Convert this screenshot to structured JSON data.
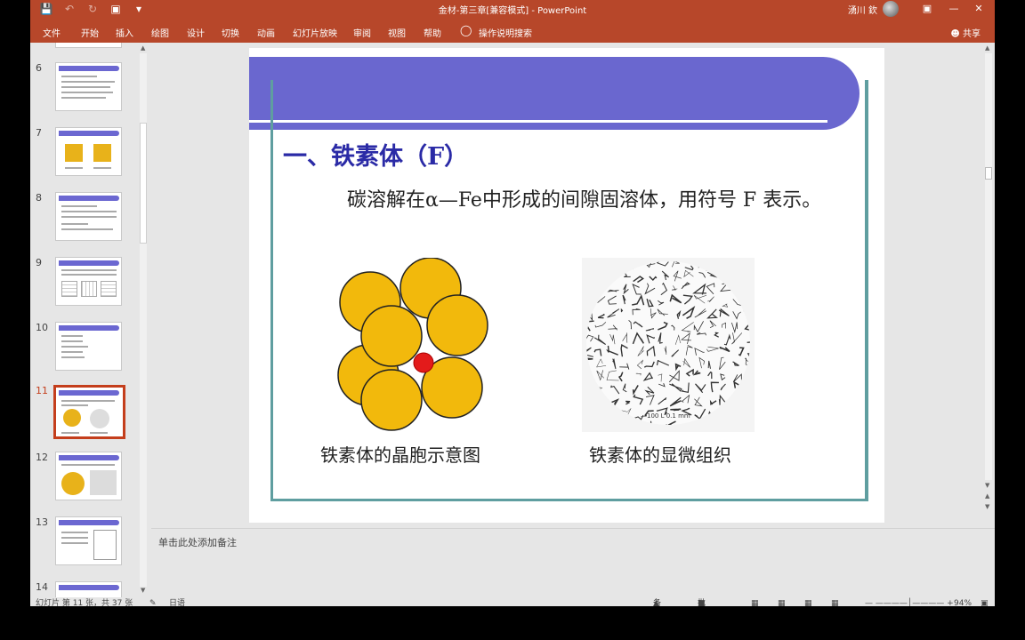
{
  "window": {
    "title": "金材-第三章[兼容模式] - PowerPoint",
    "user": "湧川 欽",
    "accent_color": "#b7472a"
  },
  "tabs": [
    "文件",
    "开始",
    "插入",
    "绘图",
    "设计",
    "切换",
    "动画",
    "幻灯片放映",
    "审阅",
    "视图",
    "帮助"
  ],
  "tellme": "操作说明搜索",
  "share": "共享",
  "thumbnails": [
    {
      "number": "6"
    },
    {
      "number": "7"
    },
    {
      "number": "8"
    },
    {
      "number": "9"
    },
    {
      "number": "10"
    },
    {
      "number": "11",
      "selected": true
    },
    {
      "number": "12"
    },
    {
      "number": "13"
    },
    {
      "number": "14"
    }
  ],
  "slide": {
    "title": "一、铁素体（F）",
    "body": "碳溶解在α—Fe中形成的间隙固溶体，用符号 F 表示。",
    "caption_left": "铁素体的晶胞示意图",
    "caption_right": "铁素体的显微组织",
    "scale_label": "—100 L  0.1 mm",
    "band_color": "#6a67cf",
    "frame_color": "#5f9ea0",
    "atom_color": "#f2b90c",
    "carbon_color": "#e31b1b"
  },
  "notes_placeholder": "单击此处添加备注",
  "status": {
    "slide_info": "幻灯片 第 11 张，共 37 张",
    "language": "日语",
    "notes_btn": "备注",
    "comments_btn": "批注",
    "zoom": "94%"
  }
}
